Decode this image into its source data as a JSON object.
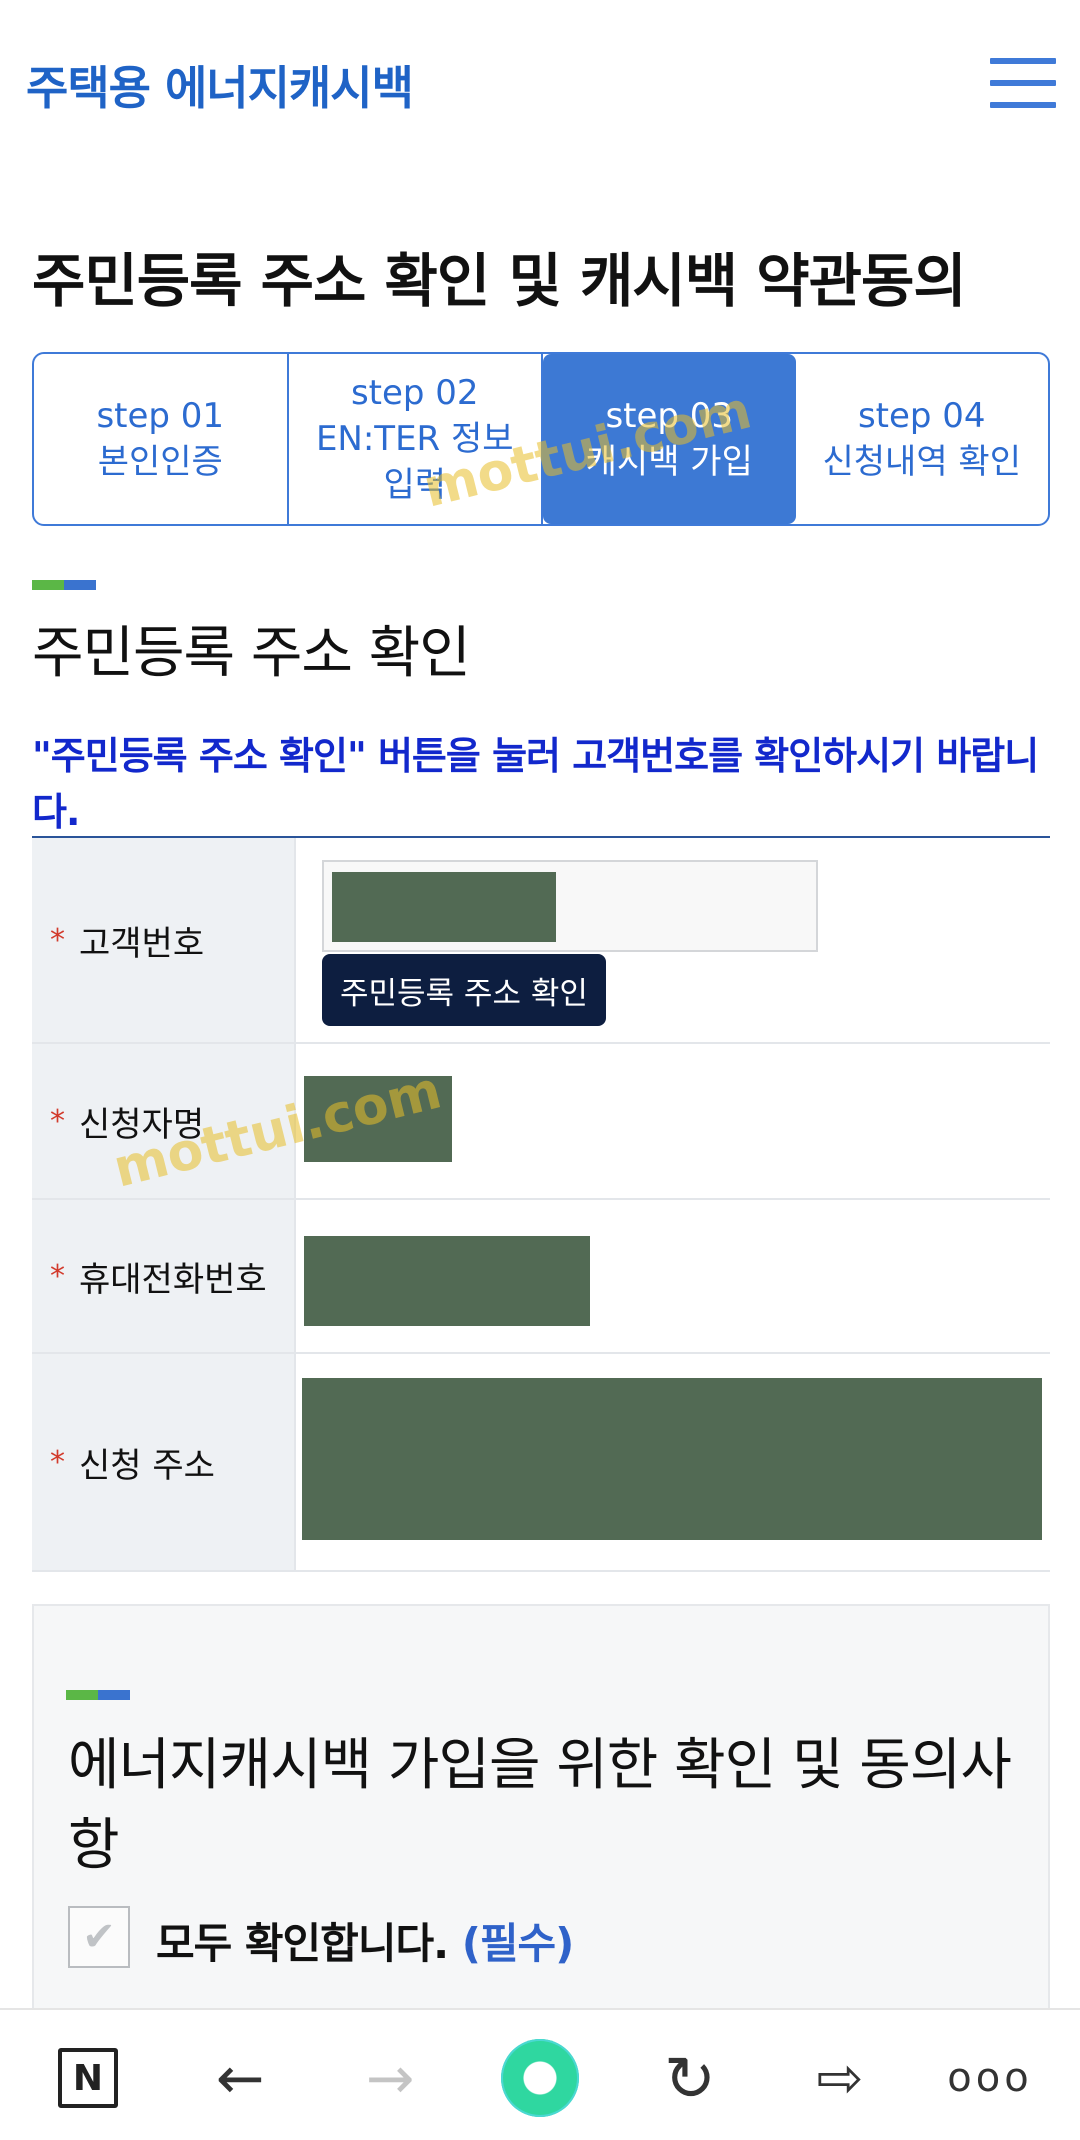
{
  "header": {
    "logo_text": "주택용 에너지캐시백"
  },
  "page_title": "주민등록 주소 확인 및 캐시백 약관동의",
  "steps": [
    {
      "num": "step 01",
      "label": "본인인증",
      "active": false
    },
    {
      "num": "step 02",
      "label": "EN:TER 정보입력",
      "active": false
    },
    {
      "num": "step 03",
      "label": "캐시백 가입",
      "active": true
    },
    {
      "num": "step 04",
      "label": "신청내역 확인",
      "active": false
    }
  ],
  "address_section": {
    "title": "주민등록 주소 확인",
    "notice": "\"주민등록 주소 확인\" 버튼을 눌러 고객번호를 확인하시기 바랍니다.",
    "required_mark": "*",
    "fields": [
      {
        "label": "고객번호"
      },
      {
        "label": "신청자명"
      },
      {
        "label": "휴대전화번호"
      },
      {
        "label": "신청 주소"
      }
    ],
    "confirm_button": "주민등록 주소 확인"
  },
  "agreement": {
    "title": "에너지캐시백 가입을 위한 확인 및 동의사항",
    "all_agree_label": "모두 확인합니다.",
    "required_tag": "(필수)",
    "checkbox_checked": false
  },
  "watermark": "mottui.com",
  "bottom_nav": {
    "logo_letter": "N",
    "back_glyph": "←",
    "forward_glyph": "→",
    "reload_glyph": "↻",
    "share_glyph": "⇨",
    "more_glyph": "ooo"
  },
  "colors": {
    "brand_blue": "#1f63c6",
    "step_active": "#3d79d4",
    "notice_blue": "#1228cc",
    "redaction": "#526a54"
  }
}
